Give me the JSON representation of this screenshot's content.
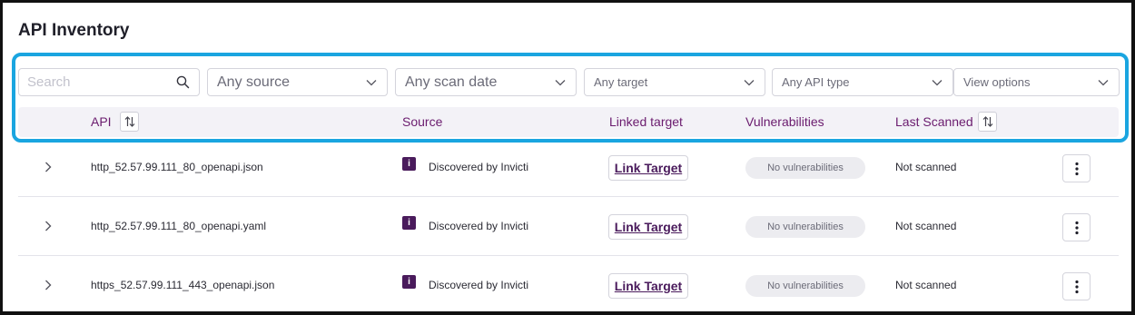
{
  "page": {
    "title": "API Inventory"
  },
  "filters": {
    "search_placeholder": "Search",
    "source": "Any source",
    "scan_date": "Any scan date",
    "target": "Any target",
    "api_type": "Any API type",
    "view_options": "View options"
  },
  "table": {
    "columns": {
      "api": "API",
      "source": "Source",
      "linked_target": "Linked target",
      "vulnerabilities": "Vulnerabilities",
      "last_scanned": "Last Scanned"
    },
    "rows": [
      {
        "api": "http_52.57.99.111_80_openapi.json",
        "source_icon": "i",
        "source": "Discovered by Invicti",
        "link_label": "Link Target",
        "vulnerabilities": "No vulnerabilities",
        "last_scanned": "Not scanned"
      },
      {
        "api": "http_52.57.99.111_80_openapi.yaml",
        "source_icon": "i",
        "source": "Discovered by Invicti",
        "link_label": "Link Target",
        "vulnerabilities": "No vulnerabilities",
        "last_scanned": "Not scanned"
      },
      {
        "api": "https_52.57.99.111_443_openapi.json",
        "source_icon": "i",
        "source": "Discovered by Invicti",
        "link_label": "Link Target",
        "vulnerabilities": "No vulnerabilities",
        "last_scanned": "Not scanned"
      }
    ]
  },
  "colors": {
    "accent": "#4a1b5c",
    "header_text": "#6a1b6e",
    "highlight": "#1aa5e0",
    "header_bg": "#f3f2f7",
    "badge_bg": "#ececf0"
  },
  "icons": {
    "search": "search-icon",
    "dropdown": "chevron-down-icon",
    "sort": "sort-icon",
    "expand": "chevron-right-icon",
    "more": "more-vertical-icon",
    "source": "invicti-icon"
  }
}
